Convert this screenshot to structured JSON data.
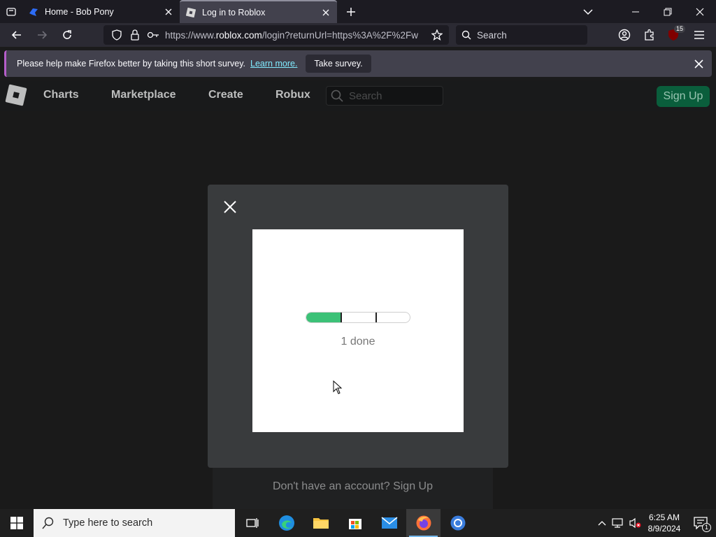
{
  "browser": {
    "tabs": [
      {
        "title": "Home - Bob Pony",
        "active": false
      },
      {
        "title": "Log in to Roblox",
        "active": true
      }
    ],
    "url_prefix": "https://www.",
    "url_domain": "roblox.com",
    "url_rest": "/login?returnUrl=https%3A%2F%2Fw",
    "search_placeholder": "Search",
    "extension_badge": "15"
  },
  "notification": {
    "message": "Please help make Firefox better by taking this short survey.",
    "link": "Learn more.",
    "button": "Take survey."
  },
  "roblox": {
    "nav": [
      "Charts",
      "Marketplace",
      "Create",
      "Robux"
    ],
    "search_placeholder": "Search",
    "signup": "Sign Up",
    "no_account": "Don't have an account? Sign Up"
  },
  "challenge": {
    "progress_fraction": 0.333,
    "segments": 3,
    "status": "1 done"
  },
  "taskbar": {
    "search_placeholder": "Type here to search",
    "time": "6:25 AM",
    "date": "8/9/2024",
    "notification_count": "1"
  },
  "colors": {
    "progress_fill": "#3cc177",
    "roblox_signup": "#0a5e3c",
    "firefox_tab_active": "#42414d"
  }
}
